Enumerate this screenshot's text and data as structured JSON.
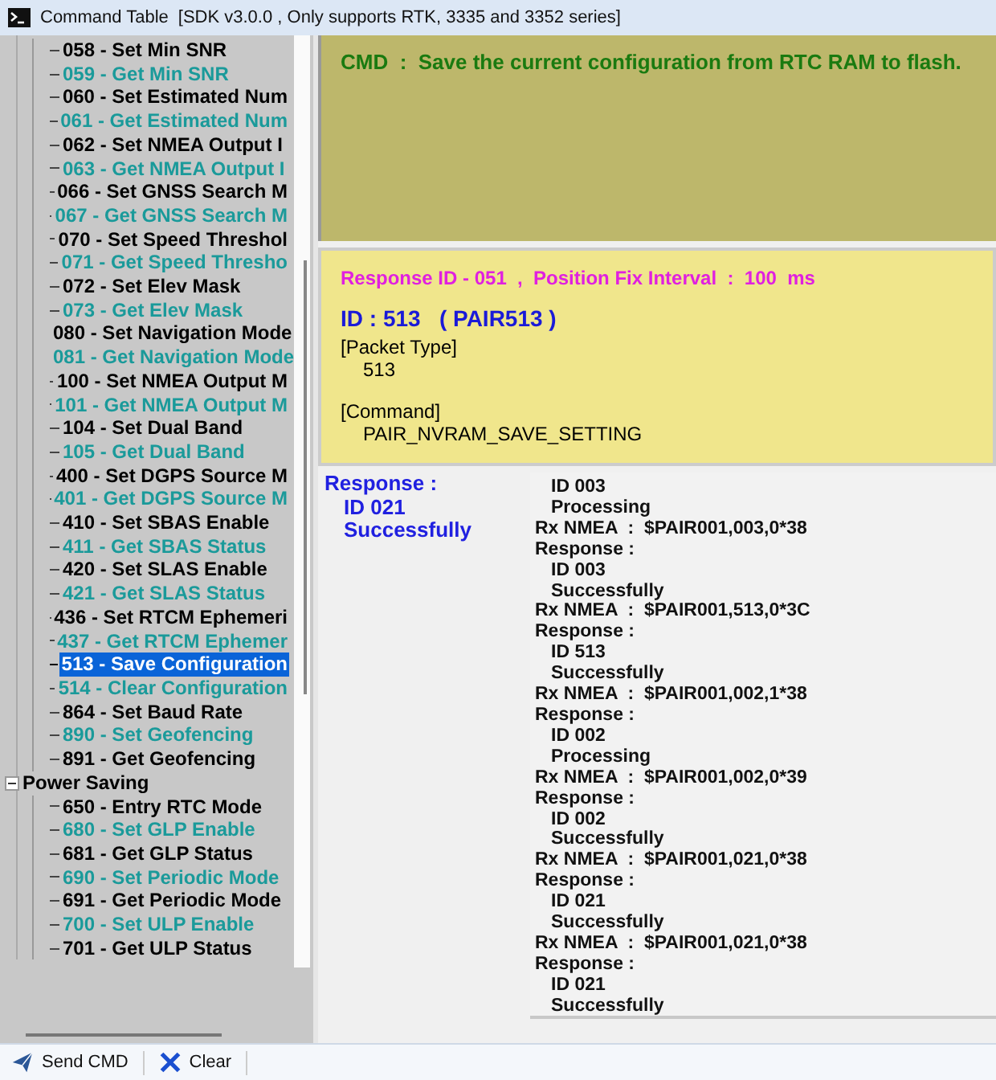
{
  "window": {
    "title": "Command Table",
    "subtitle": "[SDK v3.0.0 , Only supports RTK, 3335 and 3352 series]"
  },
  "tree": [
    {
      "children": [
        {
          "label": "058 - Set Min SNR",
          "color": "#000000",
          "selected": false
        },
        {
          "label": "059 - Get Min SNR",
          "color": "#1a9a9a",
          "selected": false
        },
        {
          "label": "060 - Set Estimated Num",
          "color": "#000000",
          "selected": false
        },
        {
          "label": "061 - Get Estimated Num",
          "color": "#1a9a9a",
          "selected": false
        },
        {
          "label": "062 - Set NMEA Output I",
          "color": "#000000",
          "selected": false
        },
        {
          "label": "063 - Get NMEA Output I",
          "color": "#1a9a9a",
          "selected": false
        },
        {
          "label": "066 - Set GNSS Search M",
          "color": "#000000",
          "selected": false
        },
        {
          "label": "067 - Get GNSS Search M",
          "color": "#1a9a9a",
          "selected": false
        },
        {
          "label": "070 - Set Speed Threshol",
          "color": "#000000",
          "selected": false
        },
        {
          "label": "071 - Get Speed Thresho",
          "color": "#1a9a9a",
          "selected": false
        },
        {
          "label": "072 - Set Elev Mask",
          "color": "#000000",
          "selected": false
        },
        {
          "label": "073 - Get Elev Mask",
          "color": "#1a9a9a",
          "selected": false
        },
        {
          "label": "080 - Set Navigation Mode",
          "color": "#000000",
          "selected": false
        },
        {
          "label": "081 - Get Navigation Mode",
          "color": "#1a9a9a",
          "selected": false
        },
        {
          "label": "100 - Set NMEA Output M",
          "color": "#000000",
          "selected": false
        },
        {
          "label": "101 - Get NMEA Output M",
          "color": "#1a9a9a",
          "selected": false
        },
        {
          "label": "104 - Set Dual Band",
          "color": "#000000",
          "selected": false
        },
        {
          "label": "105 - Get Dual Band",
          "color": "#1a9a9a",
          "selected": false
        },
        {
          "label": "400 - Set DGPS Source M",
          "color": "#000000",
          "selected": false
        },
        {
          "label": "401 - Get DGPS Source M",
          "color": "#1a9a9a",
          "selected": false
        },
        {
          "label": "410 - Set SBAS Enable",
          "color": "#000000",
          "selected": false
        },
        {
          "label": "411 - Get SBAS Status",
          "color": "#1a9a9a",
          "selected": false
        },
        {
          "label": "420 - Set SLAS Enable",
          "color": "#000000",
          "selected": false
        },
        {
          "label": "421 - Get SLAS Status",
          "color": "#1a9a9a",
          "selected": false
        },
        {
          "label": "436 - Set RTCM Ephemeri",
          "color": "#000000",
          "selected": false
        },
        {
          "label": "437 - Get RTCM Ephemer",
          "color": "#1a9a9a",
          "selected": false
        },
        {
          "label": "513 - Save Configuration",
          "color": "#000000",
          "selected": true
        },
        {
          "label": "514 - Clear Configuration",
          "color": "#1a9a9a",
          "selected": false
        },
        {
          "label": "864 - Set Baud Rate",
          "color": "#000000",
          "selected": false
        },
        {
          "label": "890 - Set Geofencing",
          "color": "#1a9a9a",
          "selected": false
        },
        {
          "label": "891 - Get Geofencing",
          "color": "#000000",
          "selected": false
        }
      ]
    },
    {
      "label": "Power Saving",
      "expanded": true,
      "children": [
        {
          "label": "650 - Entry RTC Mode",
          "color": "#000000",
          "selected": false
        },
        {
          "label": "680 - Set GLP Enable",
          "color": "#1a9a9a",
          "selected": false
        },
        {
          "label": "681 - Get GLP Status",
          "color": "#000000",
          "selected": false
        },
        {
          "label": "690 - Set Periodic Mode",
          "color": "#1a9a9a",
          "selected": false
        },
        {
          "label": "691 - Get Periodic Mode",
          "color": "#000000",
          "selected": false
        },
        {
          "label": "700 - Set ULP Enable",
          "color": "#1a9a9a",
          "selected": false
        },
        {
          "label": "701 - Get ULP Status",
          "color": "#000000",
          "selected": false
        }
      ]
    }
  ],
  "cmd": "CMD  :  Save the current configuration from RTC RAM to flash.",
  "info": {
    "response": "Response ID - 051  ,  Position Fix Interval  :  100  ms",
    "id": "ID : 513   ( PAIR513 )",
    "fields": [
      {
        "label": "[Packet Type]",
        "value": "513"
      },
      {
        "label": "[Command]",
        "value": "PAIR_NVRAM_SAVE_SETTING"
      }
    ]
  },
  "response": {
    "label": "Response :",
    "id": "ID 021",
    "status": "Successfully"
  },
  "log": [
    {
      "kind": "detail",
      "text": "ID 003"
    },
    {
      "kind": "detail",
      "text": "Processing"
    },
    {
      "kind": "line",
      "text": "Rx NMEA  :  $PAIR001,003,0*38"
    },
    {
      "kind": "line",
      "text": "Response :"
    },
    {
      "kind": "detail",
      "text": "ID 003"
    },
    {
      "kind": "detail",
      "text": "Successfully"
    },
    {
      "kind": "line",
      "text": "Rx NMEA  :  $PAIR001,513,0*3C"
    },
    {
      "kind": "line",
      "text": "Response :"
    },
    {
      "kind": "detail",
      "text": "ID 513"
    },
    {
      "kind": "detail",
      "text": "Successfully"
    },
    {
      "kind": "line",
      "text": "Rx NMEA  :  $PAIR001,002,1*38"
    },
    {
      "kind": "line",
      "text": "Response :"
    },
    {
      "kind": "detail",
      "text": "ID 002"
    },
    {
      "kind": "detail",
      "text": "Processing"
    },
    {
      "kind": "line",
      "text": "Rx NMEA  :  $PAIR001,002,0*39"
    },
    {
      "kind": "line",
      "text": "Response :"
    },
    {
      "kind": "detail",
      "text": "ID 002"
    },
    {
      "kind": "detail",
      "text": "Successfully"
    },
    {
      "kind": "line",
      "text": "Rx NMEA  :  $PAIR001,021,0*38"
    },
    {
      "kind": "line",
      "text": "Response :"
    },
    {
      "kind": "detail",
      "text": "ID 021"
    },
    {
      "kind": "detail",
      "text": "Successfully"
    },
    {
      "kind": "line",
      "text": "Rx NMEA  :  $PAIR001,021,0*38"
    },
    {
      "kind": "line",
      "text": "Response :"
    },
    {
      "kind": "detail",
      "text": "ID 021"
    },
    {
      "kind": "detail",
      "text": "Successfully"
    }
  ],
  "toolbar": [
    {
      "kind": "send",
      "label": "Send CMD"
    },
    {
      "kind": "clear",
      "label": "Clear"
    }
  ]
}
